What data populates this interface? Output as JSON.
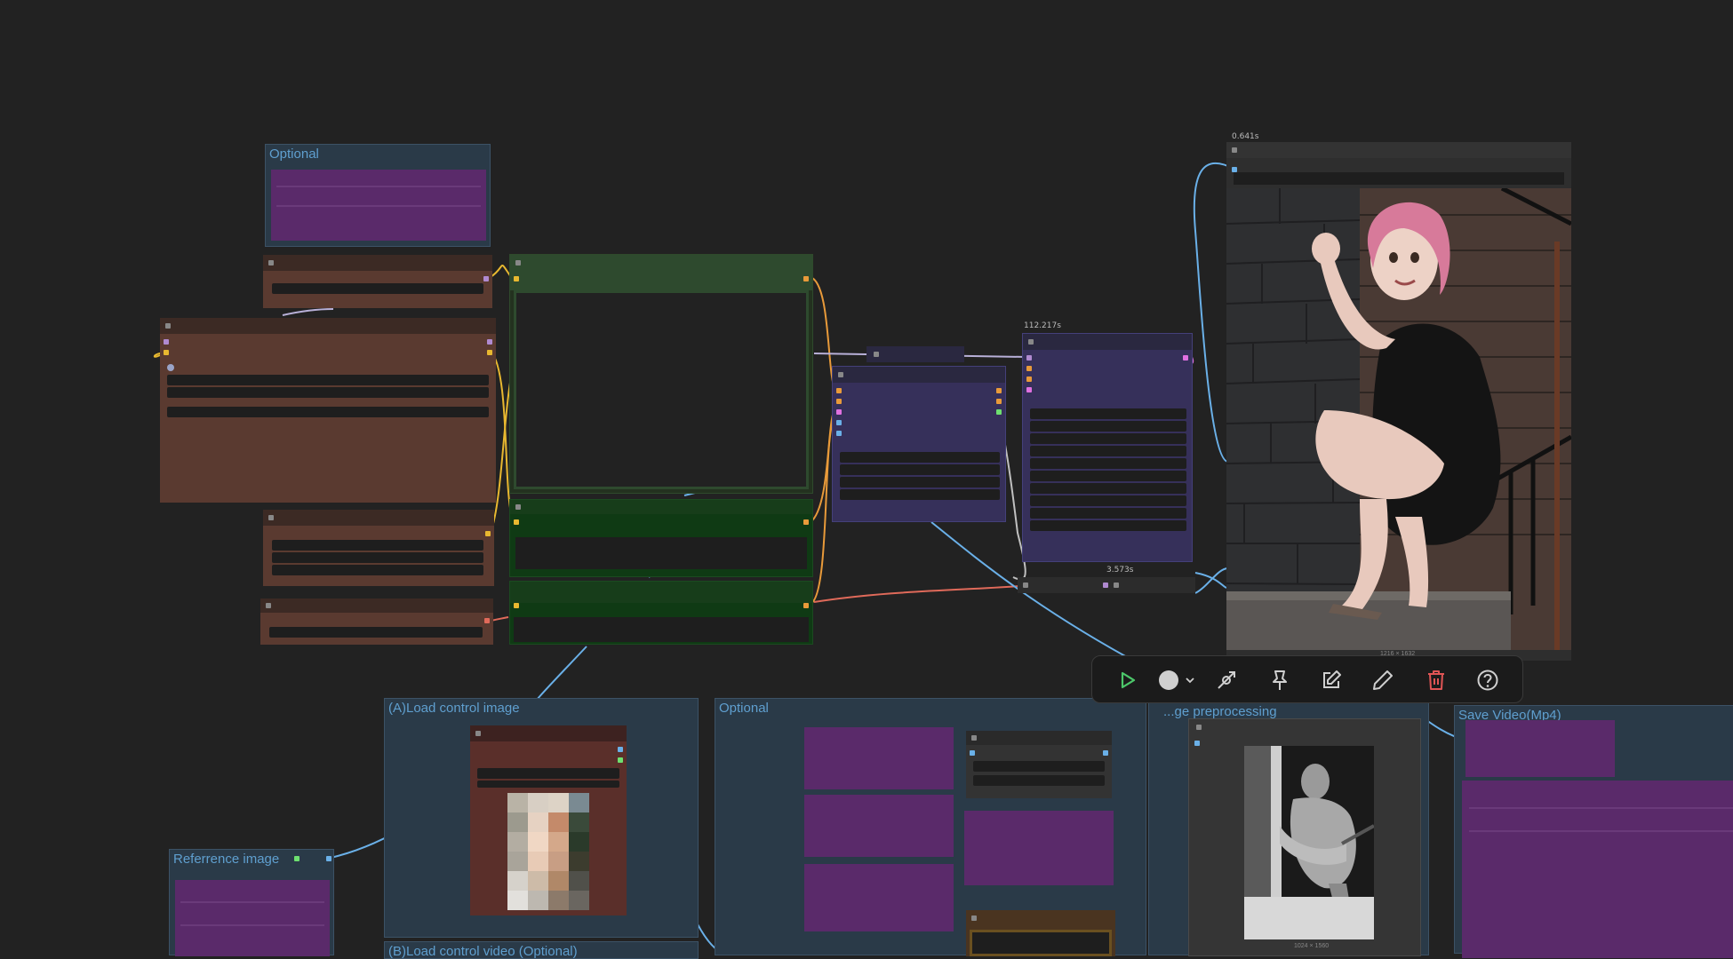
{
  "groups": {
    "optional_top": "Optional",
    "load_control_image": "(A)Load control image",
    "load_control_video": "(B)Load control video (Optional)",
    "optional_bottom": "Optional",
    "image_preprocessing": "...ge preprocessing",
    "save_video": "Save Video(Mp4)",
    "reference_image": "Referrence image"
  },
  "badges": {
    "sampler_time": "112.217s",
    "decode_time": "3.573s",
    "preview_time": "0.641s",
    "preview_size": "1216 × 1632",
    "depth_size": "1024 × 1560"
  },
  "toolbar": {
    "run": "play-icon",
    "color": "color-circle-icon",
    "bypass": "bypass-icon",
    "pin": "pin-icon",
    "edit": "edit-icon",
    "rename": "pencil-icon",
    "delete": "trash-icon",
    "help": "help-icon"
  },
  "colors": {
    "background": "#222222",
    "group_bg": "#2a3a48",
    "group_title": "#5f9fcf",
    "link_blue": "#6ab0e8",
    "link_yellow": "#e8b830",
    "link_orange": "#e89a3a",
    "link_red": "#e06a5a",
    "link_purple": "#b090e0",
    "delete_red": "#e05555",
    "run_green": "#4cc76a"
  }
}
